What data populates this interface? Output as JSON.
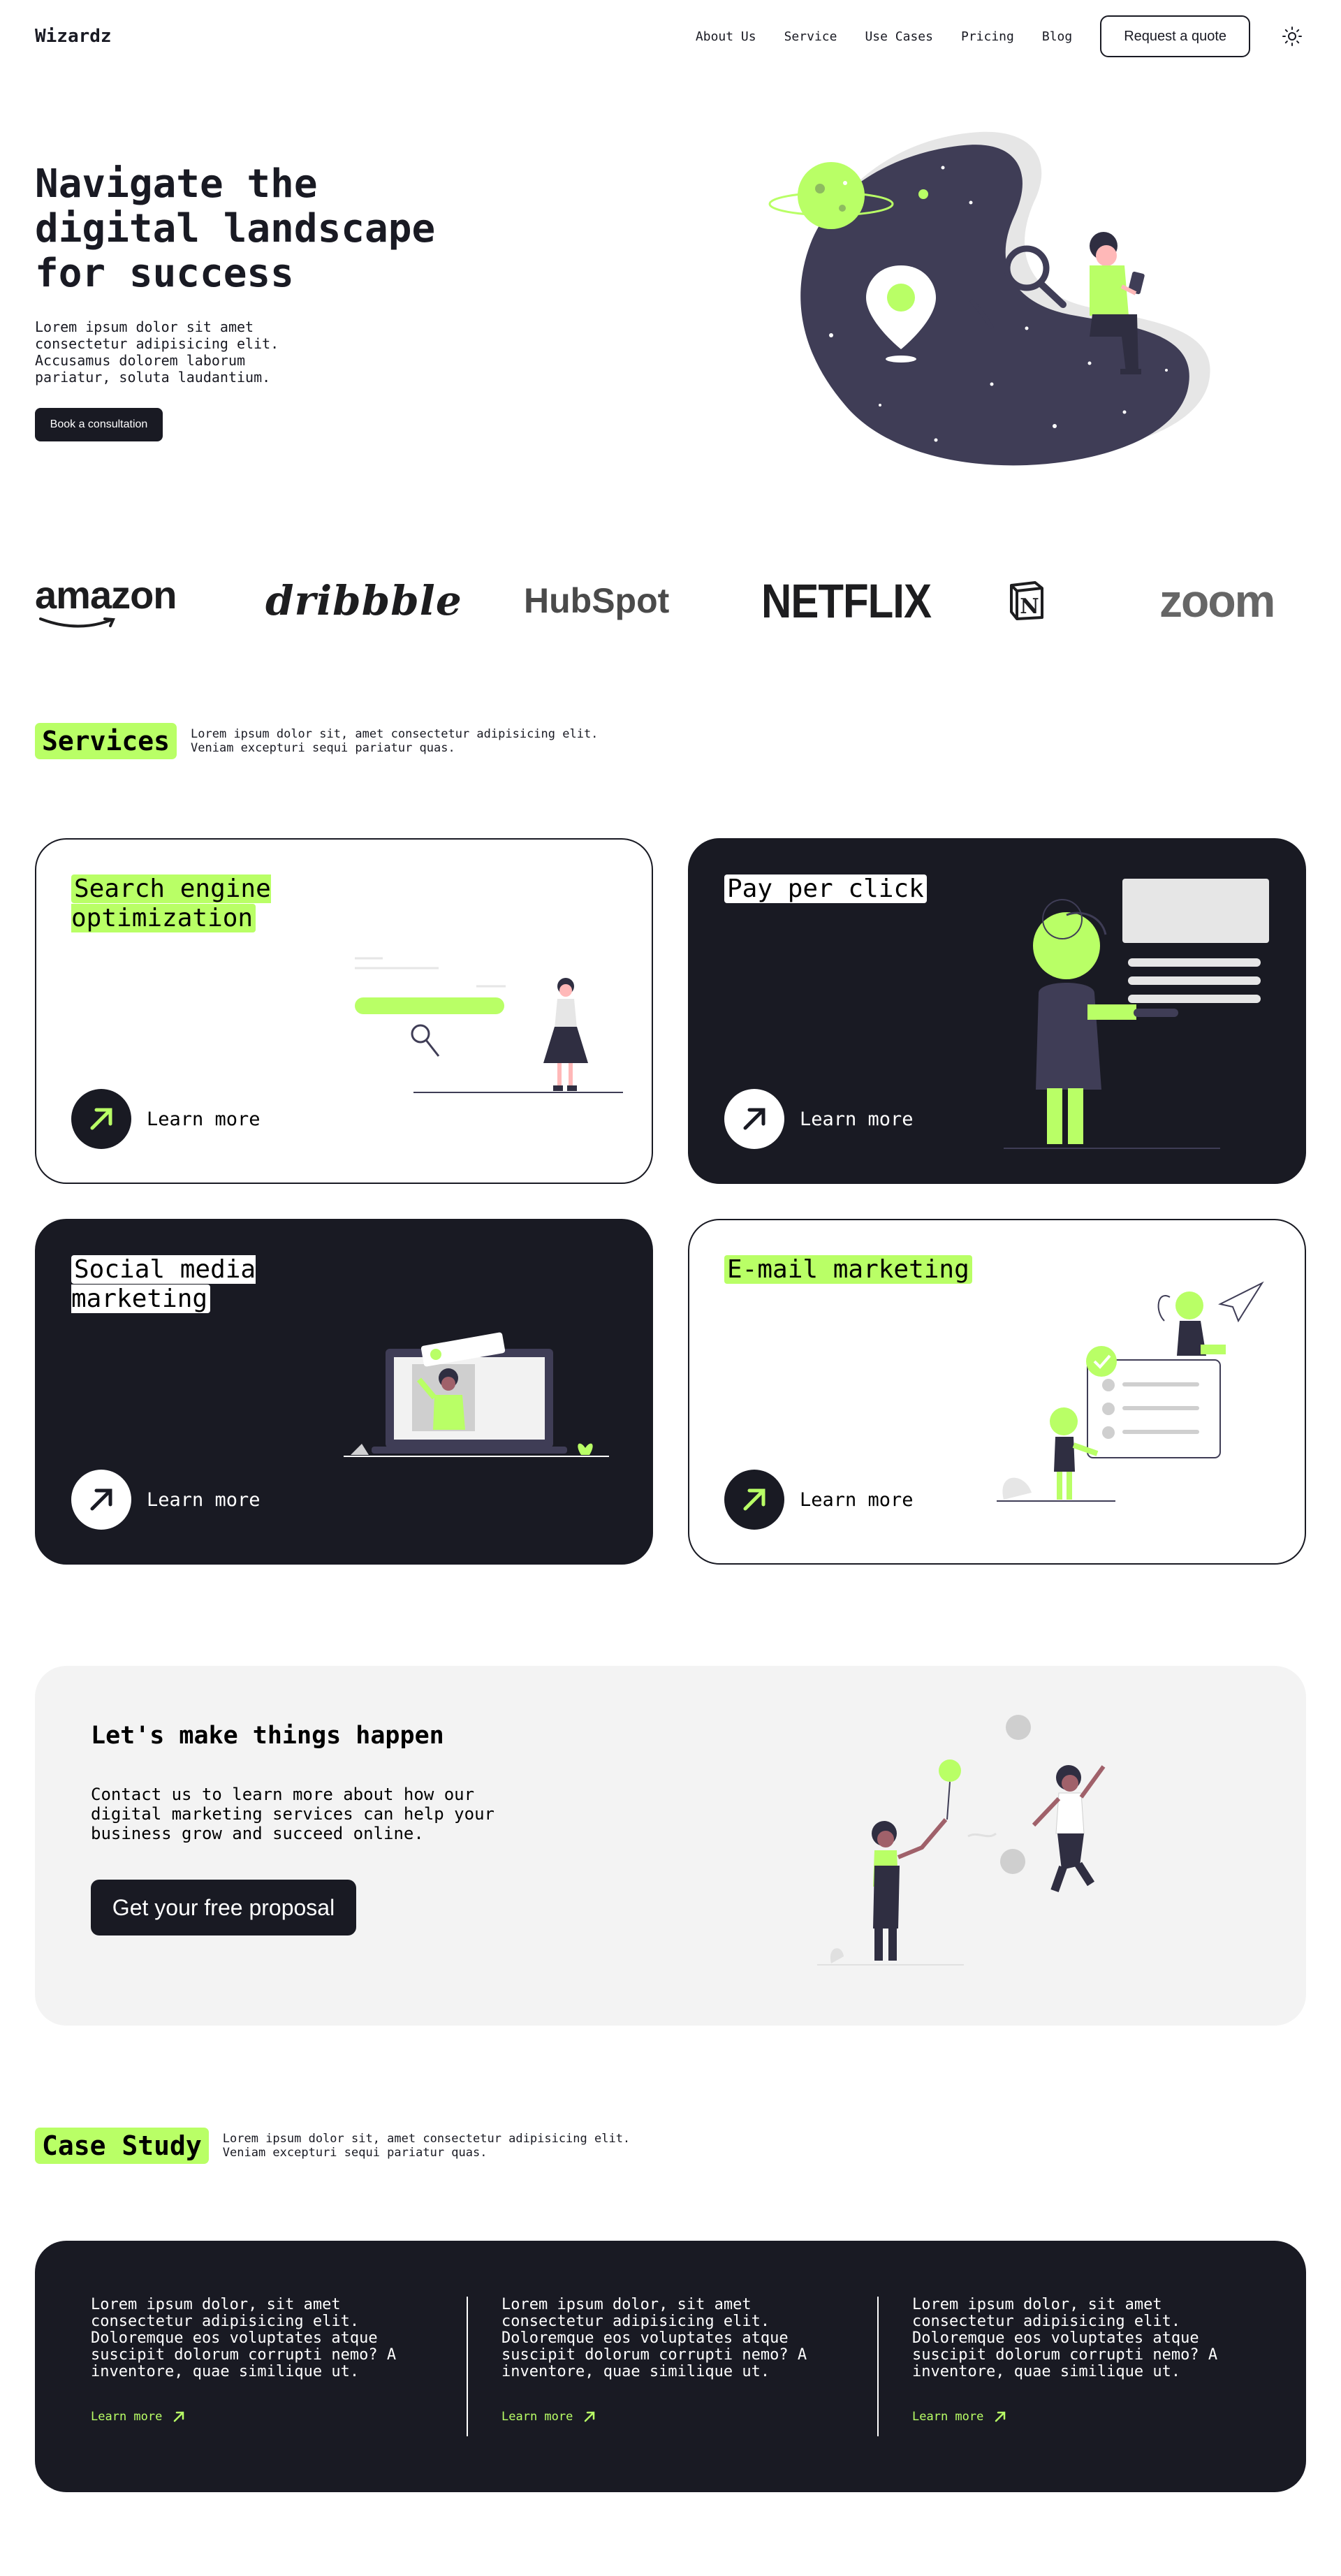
{
  "header": {
    "logo": "Wizardz",
    "nav": [
      "About Us",
      "Service",
      "Use Cases",
      "Pricing",
      "Blog"
    ],
    "quote_button": "Request a quote",
    "theme_icon": "sun-icon"
  },
  "hero": {
    "title": "Navigate the digital landscape for success",
    "text": "Lorem ipsum dolor sit amet consectetur adipisicing elit. Accusamus dolorem laborum pariatur, soluta laudantium.",
    "button": "Book a consultation"
  },
  "brands": [
    "amazon",
    "dribbble",
    "HubSpot",
    "NETFLIX",
    "N",
    "zoom"
  ],
  "services": {
    "title": "Services",
    "text": "Lorem ipsum dolor sit, amet consectetur adipisicing elit. Veniam excepturi sequi pariatur quas.",
    "cards": [
      {
        "title": "Search engine optimization",
        "cta": "Learn more",
        "theme": "light"
      },
      {
        "title": "Pay per click",
        "cta": "Learn more",
        "theme": "dark"
      },
      {
        "title": "Social media marketing",
        "cta": "Learn more",
        "theme": "dark"
      },
      {
        "title": "E-mail marketing",
        "cta": "Learn more",
        "theme": "light"
      }
    ]
  },
  "cta": {
    "title": "Let's make things happen",
    "text": "Contact us to learn more about how our digital marketing services can help your business grow and succeed online.",
    "button": "Get your free proposal"
  },
  "case_study": {
    "title": "Case Study",
    "text": "Lorem ipsum dolor sit, amet consectetur adipisicing elit. Veniam excepturi sequi pariatur quas.",
    "items": [
      {
        "text": "Lorem ipsum dolor, sit amet consectetur adipisicing elit. Doloremque eos voluptates atque suscipit dolorum corrupti nemo? A inventore, quae similique ut.",
        "link": "Learn more"
      },
      {
        "text": "Lorem ipsum dolor, sit amet consectetur adipisicing elit. Doloremque eos voluptates atque suscipit dolorum corrupti nemo? A inventore, quae similique ut.",
        "link": "Learn more"
      },
      {
        "text": "Lorem ipsum dolor, sit amet consectetur adipisicing elit. Doloremque eos voluptates atque suscipit dolorum corrupti nemo? A inventore, quae similique ut.",
        "link": "Learn more"
      }
    ]
  },
  "colors": {
    "accent": "#b9ff66",
    "dark": "#191a23",
    "light_gray": "#f3f3f3"
  }
}
